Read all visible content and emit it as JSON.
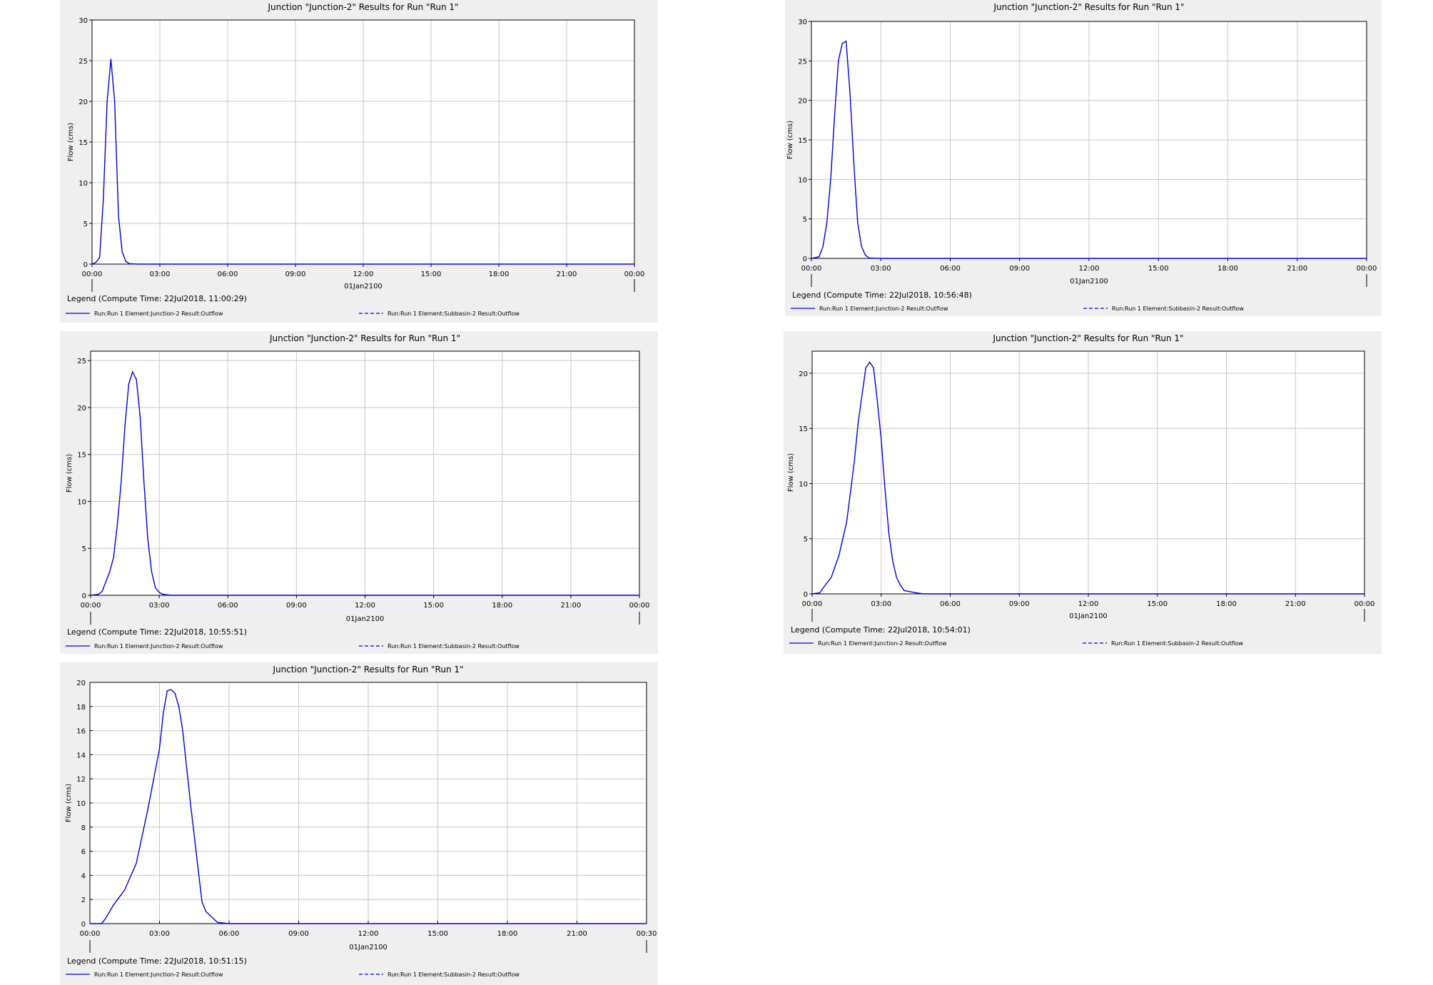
{
  "colors": {
    "series": "#0000dd",
    "grid": "#c8c8c8",
    "panel_bg": "#efefef",
    "plot_bg": "#ffffff"
  },
  "chart_data": [
    {
      "type": "line",
      "title": "Junction \"Junction-2\" Results for Run \"Run 1\"",
      "ylabel": "Flow (cms)",
      "xlabel": "01Jan2100",
      "x_unit": "hours",
      "xlim": [
        0,
        24
      ],
      "ylim": [
        0,
        30
      ],
      "yticks": [
        "0",
        "5",
        "10",
        "15",
        "20",
        "25",
        "30"
      ],
      "xticks": [
        "00:00",
        "03:00",
        "06:00",
        "09:00",
        "12:00",
        "15:00",
        "18:00",
        "21:00",
        "00:00"
      ],
      "legend_title": "Legend (Compute Time: 22Jul2018, 11:00:29)",
      "series": [
        {
          "name": "Run:Run 1 Element:Junction-2 Result:Outflow",
          "style": "solid",
          "x": [
            0,
            0.1667,
            0.3333,
            0.5,
            0.6667,
            0.8333,
            1.0,
            1.1667,
            1.3333,
            1.5,
            1.6667,
            2.0,
            24.0
          ],
          "y": [
            0,
            0.2,
            0.8,
            8.0,
            20.0,
            25.2,
            20.0,
            6.0,
            1.5,
            0.3,
            0.05,
            0,
            0
          ]
        },
        {
          "name": "Run:Run 1 Element:Subbasin-2 Result:Outflow",
          "style": "dashed",
          "x": [],
          "y": []
        }
      ]
    },
    {
      "type": "line",
      "title": "Junction \"Junction-2\" Results for Run \"Run 1\"",
      "ylabel": "Flow (cms)",
      "xlabel": "01Jan2100",
      "x_unit": "hours",
      "xlim": [
        0,
        24
      ],
      "ylim": [
        0,
        30
      ],
      "yticks": [
        "0",
        "5",
        "10",
        "15",
        "20",
        "25",
        "30"
      ],
      "xticks": [
        "00:00",
        "03:00",
        "06:00",
        "09:00",
        "12:00",
        "15:00",
        "18:00",
        "21:00",
        "00:00"
      ],
      "legend_title": "Legend (Compute Time: 22Jul2018, 10:56:48)",
      "series": [
        {
          "name": "Run:Run 1 Element:Junction-2 Result:Outflow",
          "style": "solid",
          "x": [
            0,
            0.3333,
            0.5,
            0.6667,
            0.8333,
            1.0,
            1.1667,
            1.3333,
            1.5,
            1.6667,
            1.8333,
            2.0,
            2.1667,
            2.3333,
            2.5,
            3.0,
            24.0
          ],
          "y": [
            0,
            0.2,
            1.5,
            4.5,
            10.0,
            18.0,
            25.0,
            27.2,
            27.5,
            21.0,
            12.0,
            4.5,
            1.5,
            0.4,
            0.05,
            0,
            0
          ]
        },
        {
          "name": "Run:Run 1 Element:Subbasin-2 Result:Outflow",
          "style": "dashed",
          "x": [],
          "y": []
        }
      ]
    },
    {
      "type": "line",
      "title": "Junction \"Junction-2\" Results for Run \"Run 1\"",
      "ylabel": "Flow (cms)",
      "xlabel": "01Jan2100",
      "x_unit": "hours",
      "xlim": [
        0,
        24
      ],
      "ylim": [
        0,
        26
      ],
      "yticks": [
        "0",
        "5",
        "10",
        "15",
        "20",
        "25"
      ],
      "xticks": [
        "00:00",
        "03:00",
        "06:00",
        "09:00",
        "12:00",
        "15:00",
        "18:00",
        "21:00",
        "00:00"
      ],
      "legend_title": "Legend (Compute Time: 22Jul2018, 10:55:51)",
      "series": [
        {
          "name": "Run:Run 1 Element:Junction-2 Result:Outflow",
          "style": "solid",
          "x": [
            0,
            0.3333,
            0.5,
            0.8333,
            1.0,
            1.1667,
            1.3333,
            1.5,
            1.6667,
            1.8333,
            2.0,
            2.1667,
            2.3333,
            2.5,
            2.6667,
            2.8333,
            3.0,
            3.1667,
            3.3333,
            3.5,
            24.0
          ],
          "y": [
            0,
            0.1,
            0.4,
            2.5,
            4.0,
            7.5,
            12.0,
            18.0,
            22.5,
            23.8,
            23.0,
            19.0,
            12.0,
            6.0,
            2.5,
            0.8,
            0.3,
            0.1,
            0.05,
            0,
            0
          ]
        },
        {
          "name": "Run:Run 1 Element:Subbasin-2 Result:Outflow",
          "style": "dashed",
          "x": [],
          "y": []
        }
      ]
    },
    {
      "type": "line",
      "title": "Junction \"Junction-2\" Results for Run \"Run 1\"",
      "ylabel": "Flow (cms)",
      "xlabel": "01Jan2100",
      "x_unit": "hours",
      "xlim": [
        0,
        24
      ],
      "ylim": [
        0,
        22
      ],
      "yticks": [
        "0",
        "5",
        "10",
        "15",
        "20"
      ],
      "xticks": [
        "00:00",
        "03:00",
        "06:00",
        "09:00",
        "12:00",
        "15:00",
        "18:00",
        "21:00",
        "00:00"
      ],
      "legend_title": "Legend (Compute Time: 22Jul2018, 10:54:01)",
      "series": [
        {
          "name": "Run:Run 1 Element:Junction-2 Result:Outflow",
          "style": "solid",
          "x": [
            0,
            0.3333,
            0.5,
            0.8333,
            1.0,
            1.1667,
            1.5,
            1.8333,
            2.0,
            2.1667,
            2.3333,
            2.5,
            2.6667,
            2.8333,
            3.0,
            3.1667,
            3.3333,
            3.5,
            3.6667,
            3.8333,
            4.0,
            4.5,
            4.8333,
            24.0
          ],
          "y": [
            0,
            0.1,
            0.6,
            1.5,
            2.5,
            3.5,
            6.5,
            12.0,
            15.5,
            18.0,
            20.5,
            21.0,
            20.5,
            17.5,
            14.0,
            9.5,
            5.5,
            3.0,
            1.5,
            0.8,
            0.3,
            0.1,
            0,
            0
          ]
        },
        {
          "name": "Run:Run 1 Element:Subbasin-2 Result:Outflow",
          "style": "dashed",
          "x": [],
          "y": []
        }
      ]
    },
    {
      "type": "line",
      "title": "Junction \"Junction-2\" Results for Run \"Run 1\"",
      "ylabel": "Flow (cms)",
      "xlabel": "01Jan2100",
      "x_unit": "hours",
      "xlim": [
        0,
        24
      ],
      "ylim": [
        0,
        20
      ],
      "yticks": [
        "0",
        "2",
        "4",
        "6",
        "8",
        "10",
        "12",
        "14",
        "16",
        "18",
        "20"
      ],
      "xticks": [
        "00:00",
        "03:00",
        "06:00",
        "09:00",
        "12:00",
        "15:00",
        "18:00",
        "21:00",
        "00:30"
      ],
      "legend_title": "Legend (Compute Time: 22Jul2018, 10:51:15)",
      "series": [
        {
          "name": "Run:Run 1 Element:Junction-2 Result:Outflow",
          "style": "solid",
          "x": [
            0,
            0.5,
            0.6667,
            1.0,
            1.5,
            2.0,
            2.5,
            3.0,
            3.1667,
            3.3333,
            3.5,
            3.6667,
            3.8333,
            4.0,
            4.3333,
            4.6667,
            4.8333,
            5.0,
            5.3333,
            5.5,
            6.0,
            24.0
          ],
          "y": [
            0,
            0,
            0.4,
            1.5,
            2.8,
            5.0,
            9.5,
            14.5,
            17.5,
            19.3,
            19.4,
            19.1,
            18.0,
            16.0,
            10.0,
            4.5,
            1.8,
            1.0,
            0.4,
            0.1,
            0,
            0
          ]
        },
        {
          "name": "Run:Run 1 Element:Subbasin-2 Result:Outflow",
          "style": "dashed",
          "x": [],
          "y": []
        }
      ]
    }
  ]
}
